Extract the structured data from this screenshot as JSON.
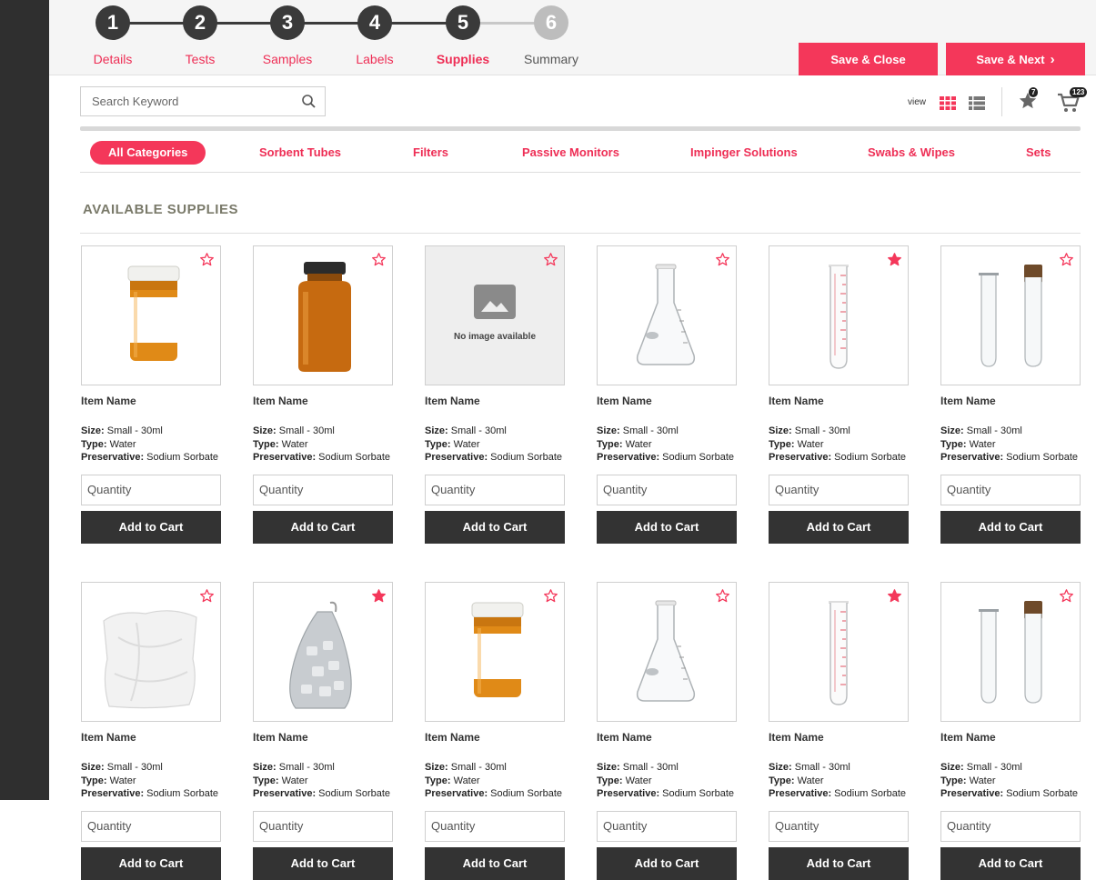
{
  "steps": [
    {
      "number": "1",
      "label": "Details",
      "state": "done"
    },
    {
      "number": "2",
      "label": "Tests",
      "state": "done"
    },
    {
      "number": "3",
      "label": "Samples",
      "state": "done"
    },
    {
      "number": "4",
      "label": "Labels",
      "state": "done"
    },
    {
      "number": "5",
      "label": "Supplies",
      "state": "active"
    },
    {
      "number": "6",
      "label": "Summary",
      "state": "inactive"
    }
  ],
  "actions": {
    "save_close": "Save & Close",
    "save_next": "Save & Next"
  },
  "search": {
    "placeholder": "Search Keyword"
  },
  "view": {
    "label": "view",
    "favorites_count": "7",
    "cart_count": "123"
  },
  "categories": [
    "All Categories",
    "Sorbent Tubes",
    "Filters",
    "Passive Monitors",
    "Impinger Solutions",
    "Swabs & Wipes",
    "Sets"
  ],
  "section_title": "AVAILABLE SUPPLIES",
  "no_image_text": "No image available",
  "labels": {
    "size": "Size:",
    "type": "Type:",
    "preservative": "Preservative:",
    "quantity_placeholder": "Quantity",
    "add_to_cart": "Add to Cart"
  },
  "products": [
    {
      "name": "Item Name",
      "size": "Small - 30ml",
      "type": "Water",
      "preservative": "Sodium Sorbate",
      "image": "pill-bottle",
      "favorite": false
    },
    {
      "name": "Item Name",
      "size": "Small - 30ml",
      "type": "Water",
      "preservative": "Sodium Sorbate",
      "image": "amber-jar",
      "favorite": false
    },
    {
      "name": "Item Name",
      "size": "Small - 30ml",
      "type": "Water",
      "preservative": "Sodium Sorbate",
      "image": "none",
      "favorite": false
    },
    {
      "name": "Item Name",
      "size": "Small - 30ml",
      "type": "Water",
      "preservative": "Sodium Sorbate",
      "image": "flask",
      "favorite": false
    },
    {
      "name": "Item Name",
      "size": "Small - 30ml",
      "type": "Water",
      "preservative": "Sodium Sorbate",
      "image": "graduated-tube",
      "favorite": true
    },
    {
      "name": "Item Name",
      "size": "Small - 30ml",
      "type": "Water",
      "preservative": "Sodium Sorbate",
      "image": "test-tubes",
      "favorite": false
    },
    {
      "name": "Item Name",
      "size": "Small - 30ml",
      "type": "Water",
      "preservative": "Sodium Sorbate",
      "image": "cloth-bag",
      "favorite": false
    },
    {
      "name": "Item Name",
      "size": "Small - 30ml",
      "type": "Water",
      "preservative": "Sodium Sorbate",
      "image": "ice-bag",
      "favorite": true
    },
    {
      "name": "Item Name",
      "size": "Small - 30ml",
      "type": "Water",
      "preservative": "Sodium Sorbate",
      "image": "pill-bottle",
      "favorite": false
    },
    {
      "name": "Item Name",
      "size": "Small - 30ml",
      "type": "Water",
      "preservative": "Sodium Sorbate",
      "image": "flask",
      "favorite": false
    },
    {
      "name": "Item Name",
      "size": "Small - 30ml",
      "type": "Water",
      "preservative": "Sodium Sorbate",
      "image": "graduated-tube",
      "favorite": true
    },
    {
      "name": "Item Name",
      "size": "Small - 30ml",
      "type": "Water",
      "preservative": "Sodium Sorbate",
      "image": "test-tubes",
      "favorite": false
    }
  ],
  "colors": {
    "accent": "#f4375a",
    "dark": "#333333",
    "rail": "#2f2f2f"
  }
}
